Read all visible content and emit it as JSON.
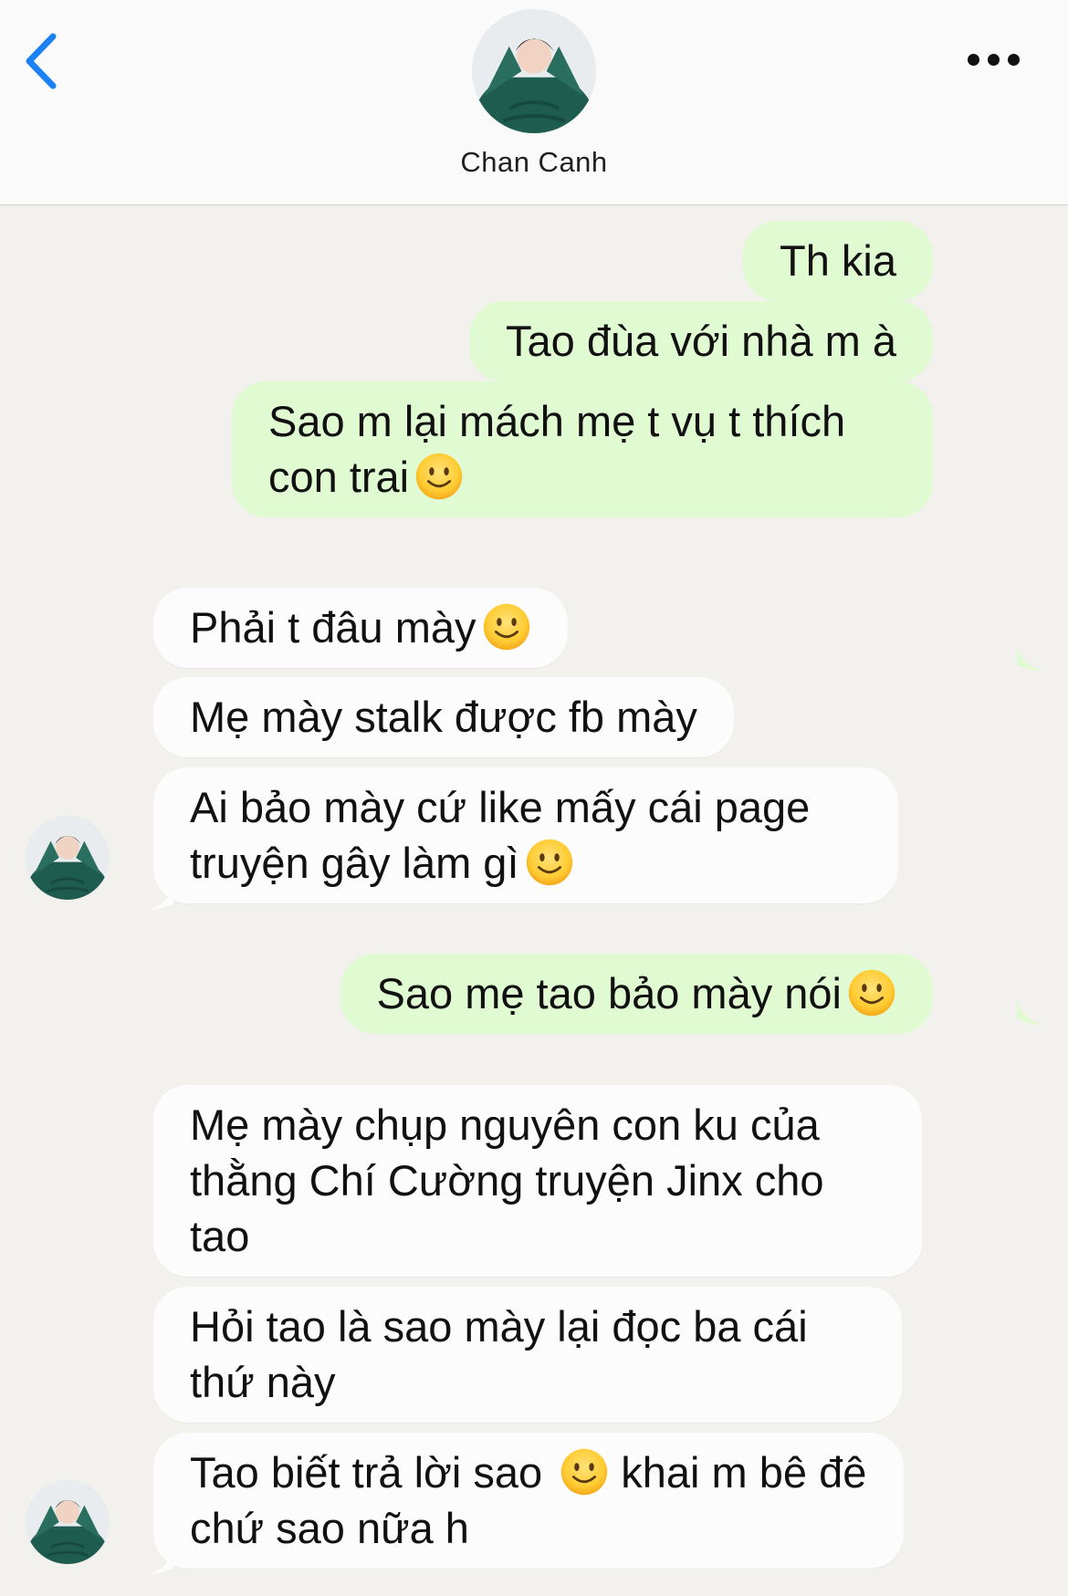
{
  "header": {
    "contact_name": "Chan Canh"
  },
  "icons": {
    "back": "chevron-left-icon",
    "more": "more-horizontal-icon",
    "emoji": "slightly-smiling-face-emoji"
  },
  "colors": {
    "accent": "#1a82f5",
    "outgoing_bubble": "#e0fad1",
    "incoming_bubble": "#fcfcfc",
    "background": "#f3f1ed"
  },
  "messages": [
    {
      "direction": "outgoing",
      "text": "Th kia",
      "emoji": false
    },
    {
      "direction": "outgoing",
      "text": "Tao đùa với nhà m à",
      "emoji": false
    },
    {
      "direction": "outgoing",
      "text": "Sao m lại mách mẹ t vụ t thích con trai",
      "emoji": true
    },
    {
      "direction": "incoming",
      "text": "Phải t đâu mày",
      "emoji": true
    },
    {
      "direction": "incoming",
      "text": "Mẹ mày stalk được fb mày",
      "emoji": false
    },
    {
      "direction": "incoming",
      "text": "Ai bảo mày cứ like mấy cái page truyện gây làm gì",
      "emoji": true
    },
    {
      "direction": "outgoing",
      "text": "Sao mẹ tao bảo mày nói",
      "emoji": true
    },
    {
      "direction": "incoming",
      "text": "Mẹ mày chụp nguyên con ku của thằng Chí Cường truyện Jinx cho tao",
      "emoji": false
    },
    {
      "direction": "incoming",
      "text": "Hỏi tao là sao mày lại đọc ba cái thứ này",
      "emoji": false
    },
    {
      "direction": "incoming",
      "text_before": "Tao biết trả lời sao",
      "text_after": "khai m bê đê chứ sao nữa h",
      "emoji": true
    }
  ]
}
